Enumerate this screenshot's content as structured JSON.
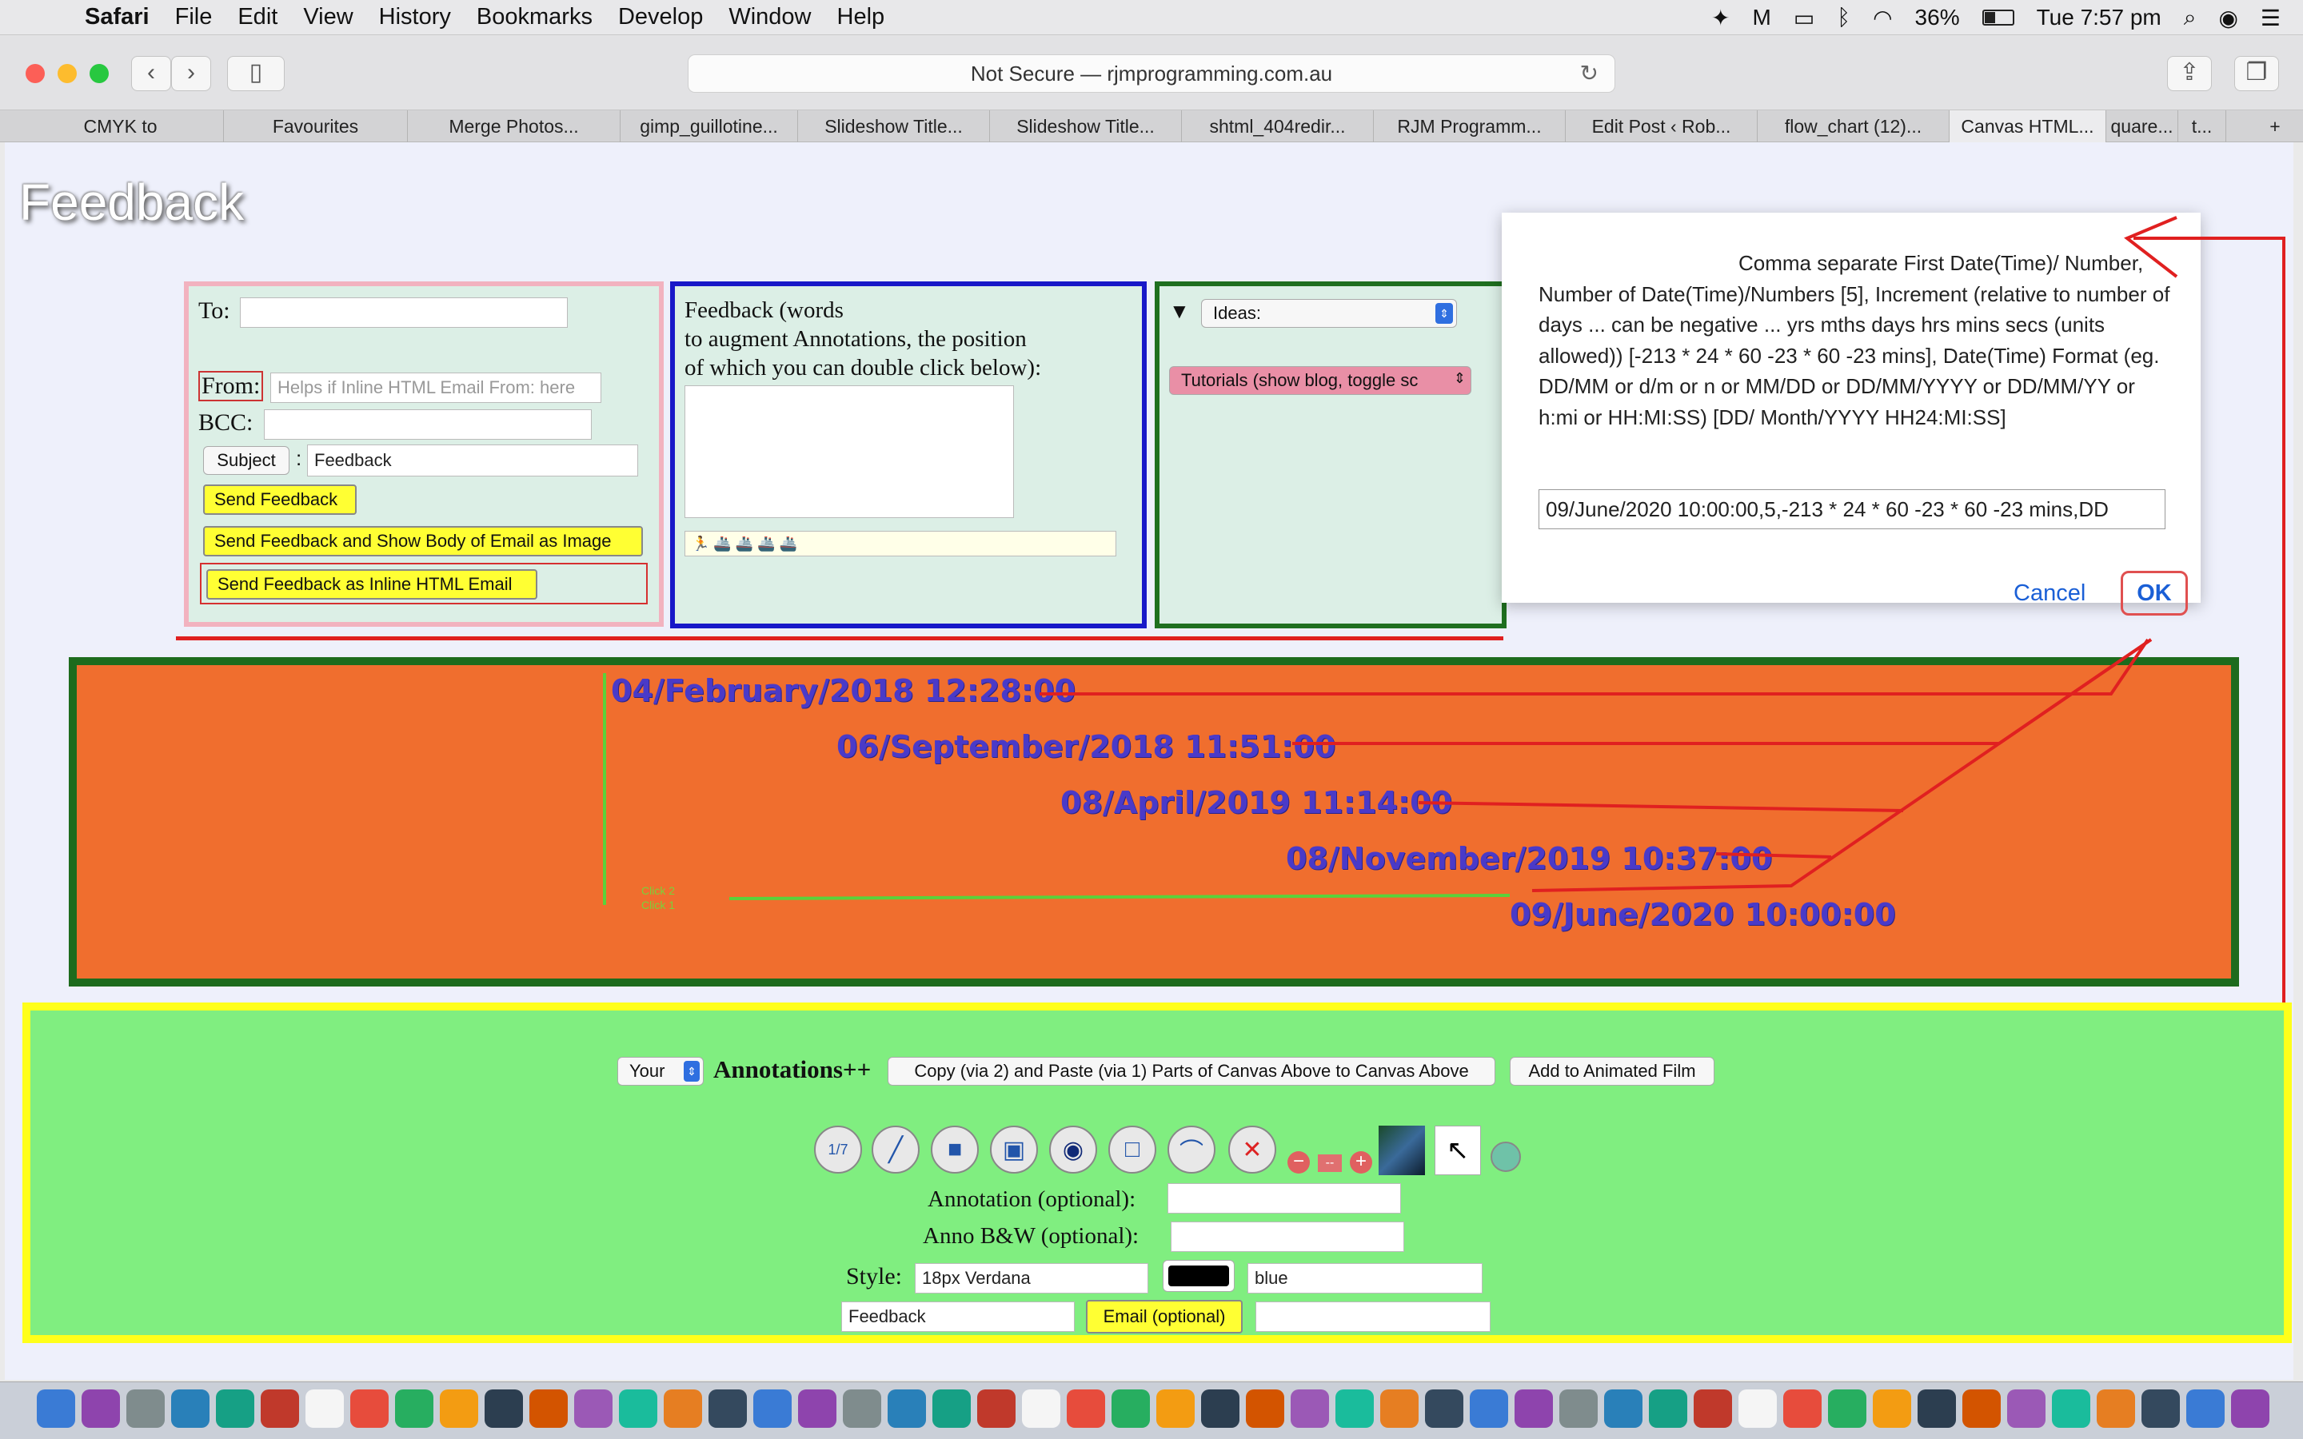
{
  "menubar": {
    "app": "Safari",
    "items": [
      "File",
      "Edit",
      "View",
      "History",
      "Bookmarks",
      "Develop",
      "Window",
      "Help"
    ],
    "battery": "36%",
    "clock": "Tue 7:57 pm"
  },
  "browser": {
    "address": "Not Secure — rjmprogramming.com.au",
    "tabs": [
      "CMYK to",
      "Favourites",
      "Merge Photos...",
      "gimp_guillotine...",
      "Slideshow Title...",
      "Slideshow Title...",
      "shtml_404redir...",
      "RJM Programm...",
      "Edit Post ‹ Rob...",
      "flow_chart (12)...",
      "Canvas HTML...",
      "quare...",
      "t..."
    ]
  },
  "page": {
    "title": "Feedback"
  },
  "email_panel": {
    "to_label": "To:",
    "to_value": "",
    "from_label": "From:",
    "from_placeholder": "Helps if Inline HTML Email From: here",
    "bcc_label": "BCC:",
    "bcc_value": "",
    "subject_button": "Subject",
    "subject_sep": ":",
    "subject_value": "Feedback",
    "send_button": "Send Feedback",
    "send_image_button": "Send Feedback and Show Body of Email as Image",
    "send_inline_button": "Send Feedback as Inline HTML Email"
  },
  "feedback_panel": {
    "text": "Feedback (words to augment Annotations, the position of which you can double click below):",
    "line1": "Feedback (words",
    "line2": "to augment Annotations, the position",
    "line3": "of which you can double click below):",
    "emoji_strip": "🏃 🚢 🚢 🚢 🚢"
  },
  "ideas_panel": {
    "triangle": "▼",
    "ideas_select": "Ideas:",
    "tutorials_select": "Tutorials (show blog, toggle sc"
  },
  "dialog": {
    "message": "Comma separate First Date(Time)/ Number, Number of Date(Time)/Numbers [5], Increment (relative to number of days ... can be negative ... yrs mths days hrs mins secs (units allowed)) [-213 * 24 * 60 -23 * 60 -23 mins], Date(Time) Format (eg. DD/MM or d/m or n or MM/DD or DD/MM/YYYY or DD/MM/YY or h:mi or HH:MI:SS) [DD/ Month/YYYY HH24:MI:SS]",
    "input_value": "09/June/2020 10:00:00,5,-213 * 24 * 60 -23 * 60 -23 mins,DD",
    "cancel": "Cancel",
    "ok": "OK"
  },
  "canvas": {
    "dates": [
      "04/February/2018 12:28:00",
      "06/September/2018 11:51:00",
      "08/April/2019 11:14:00",
      "08/November/2019 10:37:00",
      "09/June/2020 10:00:00"
    ],
    "click2": "Click 2",
    "click1": "Click 1"
  },
  "annotations": {
    "your_select": "Your",
    "title": "Annotations++",
    "copy_button": "Copy (via 2) and Paste (via 1) Parts of Canvas Above to Canvas Above",
    "film_button": "Add to Animated Film",
    "annotation_label": "Annotation (optional):",
    "annotation_value": "",
    "bw_label": "Anno B&W (optional):",
    "bw_value": "",
    "style_label": "Style:",
    "style_value": "18px Verdana",
    "color_value": "blue",
    "subject_value": "Feedback",
    "email_button": "Email (optional)",
    "email_value": "",
    "tool_glyphs": [
      "1/7",
      "╱",
      "■",
      "▣",
      "◉",
      "□",
      "⌒",
      "✕"
    ]
  },
  "colors": {
    "canvas_bg": "#f06e2e",
    "canvas_border": "#1d6b1d",
    "date_text": "#4a3ac8",
    "bottom_bg": "#80ee80",
    "bottom_border": "#ffff1a",
    "ok_link": "#1a5fd6"
  }
}
